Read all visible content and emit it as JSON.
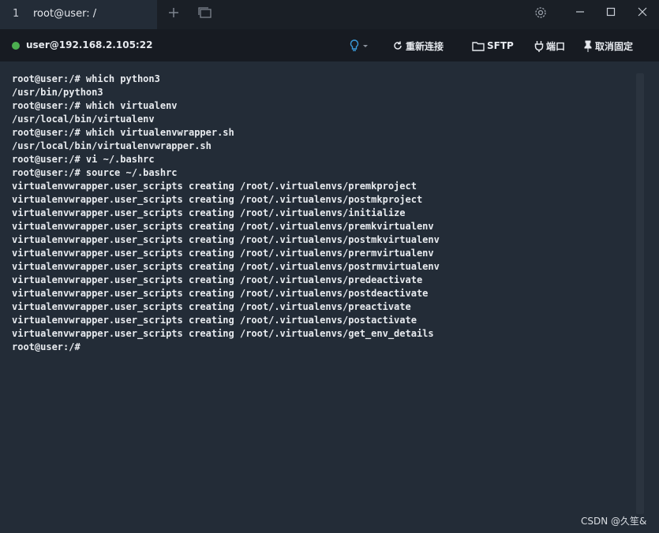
{
  "tab": {
    "number": "1",
    "title": "root@user: /"
  },
  "toolbar": {
    "connection": "user@192.168.2.105:22",
    "reconnect": "重新连接",
    "sftp": "SFTP",
    "port": "端口",
    "unpin": "取消固定"
  },
  "terminal": {
    "lines": [
      "root@user:/# which python3",
      "/usr/bin/python3",
      "root@user:/# which virtualenv",
      "/usr/local/bin/virtualenv",
      "root@user:/# which virtualenvwrapper.sh",
      "/usr/local/bin/virtualenvwrapper.sh",
      "root@user:/# vi ~/.bashrc",
      "root@user:/# source ~/.bashrc",
      "virtualenvwrapper.user_scripts creating /root/.virtualenvs/premkproject",
      "virtualenvwrapper.user_scripts creating /root/.virtualenvs/postmkproject",
      "virtualenvwrapper.user_scripts creating /root/.virtualenvs/initialize",
      "virtualenvwrapper.user_scripts creating /root/.virtualenvs/premkvirtualenv",
      "virtualenvwrapper.user_scripts creating /root/.virtualenvs/postmkvirtualenv",
      "virtualenvwrapper.user_scripts creating /root/.virtualenvs/prermvirtualenv",
      "virtualenvwrapper.user_scripts creating /root/.virtualenvs/postrmvirtualenv",
      "virtualenvwrapper.user_scripts creating /root/.virtualenvs/predeactivate",
      "virtualenvwrapper.user_scripts creating /root/.virtualenvs/postdeactivate",
      "virtualenvwrapper.user_scripts creating /root/.virtualenvs/preactivate",
      "virtualenvwrapper.user_scripts creating /root/.virtualenvs/postactivate",
      "virtualenvwrapper.user_scripts creating /root/.virtualenvs/get_env_details",
      "root@user:/# "
    ]
  },
  "watermark": "CSDN @久笙&",
  "colors": {
    "accent": "#4caf50",
    "bulb": "#3a9ad9"
  }
}
